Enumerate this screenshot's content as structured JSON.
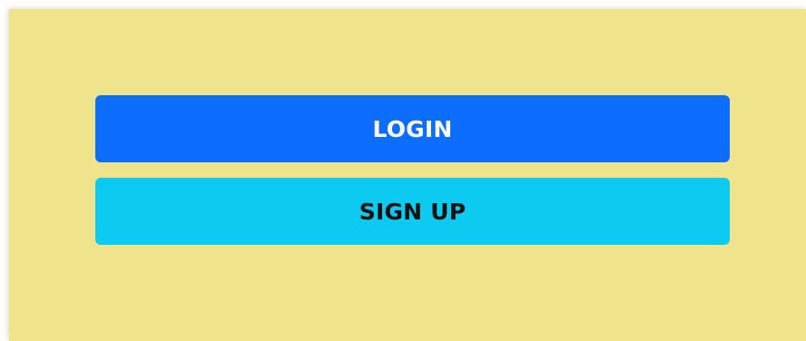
{
  "colors": {
    "panel_background": "#efe48c",
    "login_background": "#0d6efd",
    "signup_background": "#0dcaf0"
  },
  "actions": {
    "login_label": "LOGIN",
    "signup_label": "SIGN UP"
  }
}
